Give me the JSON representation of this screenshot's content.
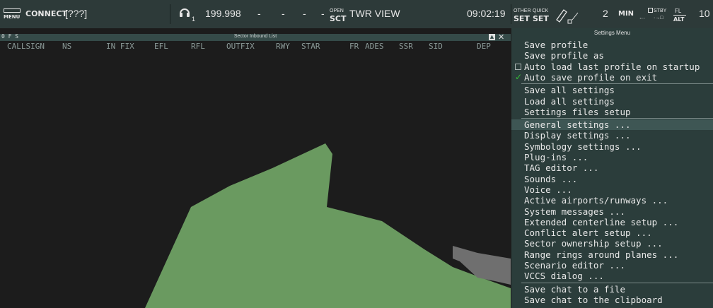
{
  "toolbar": {
    "menu_icon_label": "MENU",
    "connect_label": "CONNECT",
    "callsign": "[???]",
    "headset_sub": "1",
    "frequency": "199.998",
    "dash_fields": [
      "-",
      "-",
      "-",
      "-"
    ],
    "open_label": "OPEN",
    "sct_label": "SCT",
    "view_name": "TWR VIEW",
    "time": "09:02:19",
    "other_set_top": "OTHER",
    "other_set_bottom": "SET",
    "quick_set_top": "QUICK",
    "quick_set_bottom": "SET",
    "count": "2",
    "min_label": "MIN",
    "stby_label": "STBY",
    "fl_top": "FL",
    "fl_bottom": "ALT",
    "right_value": "10"
  },
  "sil": {
    "flags": "0 F S",
    "title": "Sector Inbound List",
    "columns": [
      {
        "key": "callsign",
        "label": "CALLSIGN"
      },
      {
        "key": "ns",
        "label": "NS"
      },
      {
        "key": "in_fix",
        "label": "IN FIX"
      },
      {
        "key": "efl",
        "label": "EFL"
      },
      {
        "key": "rfl",
        "label": "RFL"
      },
      {
        "key": "out_fix",
        "label": "OUTFIX"
      },
      {
        "key": "rwy",
        "label": "RWY"
      },
      {
        "key": "star",
        "label": "STAR"
      },
      {
        "key": "fr",
        "label": "FR"
      },
      {
        "key": "ades",
        "label": "ADES"
      },
      {
        "key": "ssr",
        "label": "SSR"
      },
      {
        "key": "sid",
        "label": "SID"
      },
      {
        "key": "dep",
        "label": "DEP"
      }
    ]
  },
  "settings_menu": {
    "title": "Settings Menu",
    "groups": [
      [
        {
          "label": "Save profile"
        },
        {
          "label": "Save profile as"
        },
        {
          "label": "Auto load last profile on startup",
          "checkbox": true,
          "checked": false
        },
        {
          "label": "Auto save profile on exit",
          "checkbox": true,
          "checked": true
        }
      ],
      [
        {
          "label": "Save all settings"
        },
        {
          "label": "Load all settings"
        },
        {
          "label": "Settings files setup"
        }
      ],
      [
        {
          "label": "General settings ...",
          "highlighted": true
        },
        {
          "label": "Display settings ..."
        },
        {
          "label": "Symbology settings ..."
        },
        {
          "label": "Plug-ins ..."
        },
        {
          "label": "TAG editor ..."
        },
        {
          "label": "Sounds ..."
        },
        {
          "label": "Voice ..."
        },
        {
          "label": "Active airports/runways ..."
        },
        {
          "label": "System messages ..."
        },
        {
          "label": "Extended centerline setup ..."
        },
        {
          "label": "Conflict alert setup ..."
        },
        {
          "label": "Sector ownership setup ..."
        },
        {
          "label": "Range rings around planes ..."
        },
        {
          "label": "Scenario editor ..."
        },
        {
          "label": "VCCS dialog ..."
        }
      ],
      [
        {
          "label": "Save chat to a file"
        },
        {
          "label": "Save chat to the clipboard"
        }
      ]
    ]
  },
  "colors": {
    "toolbar_bg": "#2d3a39",
    "map_bg": "#1c1c1c",
    "land": "#6a9a60",
    "runway_area": "#6f6f6f",
    "menu_bg": "#2b3d3b",
    "menu_highlight": "#3e5654",
    "check_green": "#36c236"
  }
}
